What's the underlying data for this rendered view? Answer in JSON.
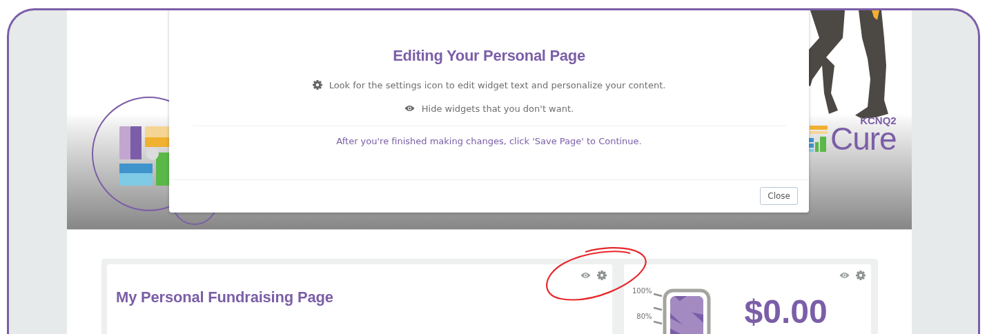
{
  "header": {
    "logo": {
      "small": "KCNQ2",
      "large": "Cure"
    }
  },
  "modal": {
    "title": "Editing Your Personal Page",
    "tips": [
      {
        "kind": "settings",
        "text": "Look for the settings icon to edit widget text and personalize your content."
      },
      {
        "kind": "hide",
        "text": "Hide widgets that you don't want."
      }
    ],
    "note": "After you're finished making changes, click 'Save Page' to Continue.",
    "close_button": "Close"
  },
  "widgets": [
    {
      "kind": "title",
      "title": "My Personal Fundraising Page"
    },
    {
      "kind": "thermometer",
      "scale": [
        "100%",
        "80%"
      ],
      "amount": "$0.00"
    }
  ]
}
